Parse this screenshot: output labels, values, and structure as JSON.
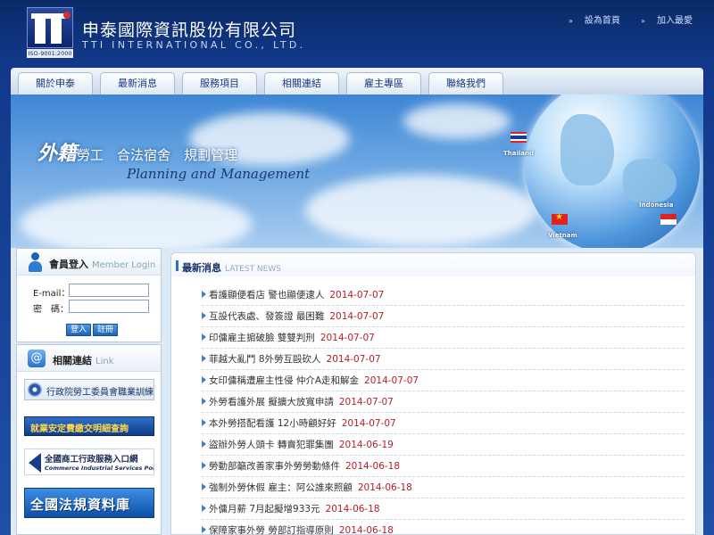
{
  "header": {
    "logo_iso": "ISO-9001:2000",
    "company_cn": "申泰國際資訊股份有限公司",
    "company_en": "TTI INTERNATIONAL CO., LTD.",
    "set_home": "設為首頁",
    "add_fav": "加入最愛"
  },
  "nav": [
    "關於申泰",
    "最新消息",
    "服務項目",
    "相關連結",
    "雇主專區",
    "聯絡我們"
  ],
  "banner": {
    "slogan_big": "外籍",
    "slogan_rest": "勞工　合法宿舍　規劃管理",
    "slogan_en": "Planning and Management",
    "countries": [
      "Thailand",
      "Vietnam",
      "Indonesia"
    ]
  },
  "login": {
    "title": "會員登入",
    "title_en": "Member Login",
    "email_label": "E-mail：",
    "password_label": "密　碼：",
    "login_button": "登入",
    "register_button": "註冊"
  },
  "links": {
    "title": "相關連結",
    "title_en": "Link",
    "items": [
      "行政院勞工委員會職業訓練局",
      "就業安定費繳交明細查詢",
      "全國商工行政服務入口網",
      "Commerce Industrial Services Portal",
      "全國法規資料庫"
    ]
  },
  "news": {
    "title": "最新消息",
    "title_en": "LATEST NEWS",
    "items": [
      {
        "text": "看護顯便看店 警也顯便逮人",
        "date": "2014-07-07"
      },
      {
        "text": "互設代表處、發簽證 最困難",
        "date": "2014-07-07"
      },
      {
        "text": "印傭雇主掮破臉 雙雙判刑",
        "date": "2014-07-07"
      },
      {
        "text": "菲越大亂鬥 8外勞互毆砍人",
        "date": "2014-07-07"
      },
      {
        "text": "女印傭稱遭雇主性侵 仲介A走和解金",
        "date": "2014-07-07"
      },
      {
        "text": "外勞看護外展 擬擴大放寬申請",
        "date": "2014-07-07"
      },
      {
        "text": "本外勞搭配看護 12小時顧好好",
        "date": "2014-07-07"
      },
      {
        "text": "盜辦外勞人頭卡 轉賣犯罪集團",
        "date": "2014-06-19"
      },
      {
        "text": "勞動部籲改善家事外勞勞動條件",
        "date": "2014-06-18"
      },
      {
        "text": "強制外勞休假 雇主：阿公誰來照顧",
        "date": "2014-06-18"
      },
      {
        "text": "外傭月薪 7月起擬增933元",
        "date": "2014-06-18"
      },
      {
        "text": "保障家事外勞 勞部訂指導原則",
        "date": "2014-06-18"
      }
    ]
  }
}
